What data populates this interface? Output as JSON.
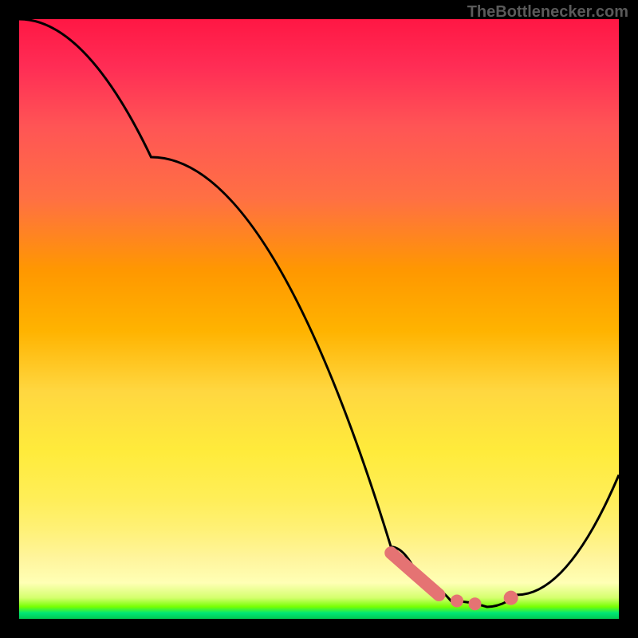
{
  "attribution": "TheBottlenecker.com",
  "chart_data": {
    "type": "line",
    "title": "",
    "xlabel": "",
    "ylabel": "",
    "x_range": [
      0,
      100
    ],
    "y_range": [
      0,
      100
    ],
    "series": [
      {
        "name": "bottleneck-curve",
        "points": [
          {
            "x": 0,
            "y": 100
          },
          {
            "x": 22,
            "y": 77
          },
          {
            "x": 62,
            "y": 12
          },
          {
            "x": 67,
            "y": 6
          },
          {
            "x": 72,
            "y": 3
          },
          {
            "x": 78,
            "y": 2
          },
          {
            "x": 83,
            "y": 4
          },
          {
            "x": 100,
            "y": 24
          }
        ]
      }
    ],
    "markers": [
      {
        "name": "highlight-segment-1",
        "x_start": 62,
        "x_end": 70,
        "y_start": 11,
        "y_end": 4
      },
      {
        "name": "highlight-dot-1",
        "x": 73,
        "y": 3
      },
      {
        "name": "highlight-dot-2",
        "x": 76,
        "y": 2.5
      },
      {
        "name": "highlight-dot-3",
        "x": 82,
        "y": 3.5
      }
    ],
    "background_gradient": {
      "top": "#ff1744",
      "mid": "#ffeb3b",
      "bottom": "#00c853"
    }
  }
}
